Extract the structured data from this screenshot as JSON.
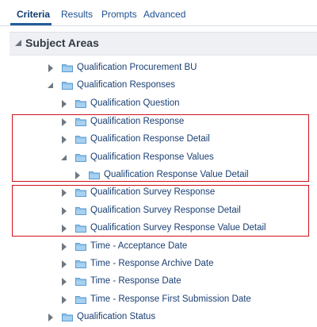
{
  "tabs": [
    {
      "label": "Criteria",
      "active": true
    },
    {
      "label": "Results",
      "active": false
    },
    {
      "label": "Prompts",
      "active": false
    },
    {
      "label": "Advanced",
      "active": false
    }
  ],
  "panel": {
    "title": "Subject Areas"
  },
  "tree": [
    {
      "label": "Qualification Procurement BU",
      "state": "collapsed"
    },
    {
      "label": "Qualification Responses",
      "state": "expanded"
    },
    {
      "label": "Qualification Question",
      "state": "collapsed"
    },
    {
      "label": "Qualification Response",
      "state": "collapsed"
    },
    {
      "label": "Qualification Response Detail",
      "state": "collapsed"
    },
    {
      "label": "Qualification Response Values",
      "state": "expanded"
    },
    {
      "label": "Qualification Response Value Detail",
      "state": "collapsed"
    },
    {
      "label": "Qualification Survey Response",
      "state": "collapsed"
    },
    {
      "label": "Qualification Survey Response Detail",
      "state": "collapsed"
    },
    {
      "label": "Qualification Survey Response Value Detail",
      "state": "collapsed"
    },
    {
      "label": "Time - Acceptance Date",
      "state": "collapsed"
    },
    {
      "label": "Time - Response Archive Date",
      "state": "collapsed"
    },
    {
      "label": "Time - Response Date",
      "state": "collapsed"
    },
    {
      "label": "Time - Response First Submission Date",
      "state": "collapsed"
    },
    {
      "label": "Qualification Status",
      "state": "collapsed"
    }
  ],
  "colors": {
    "highlight_border": "#d0121b",
    "folder_fill": "#8cc1e8",
    "link_text": "#1a3f73"
  },
  "icons": {
    "folder": "folder-icon",
    "toggle_collapsed": "triangle-right-icon",
    "toggle_expanded": "triangle-down-icon"
  }
}
